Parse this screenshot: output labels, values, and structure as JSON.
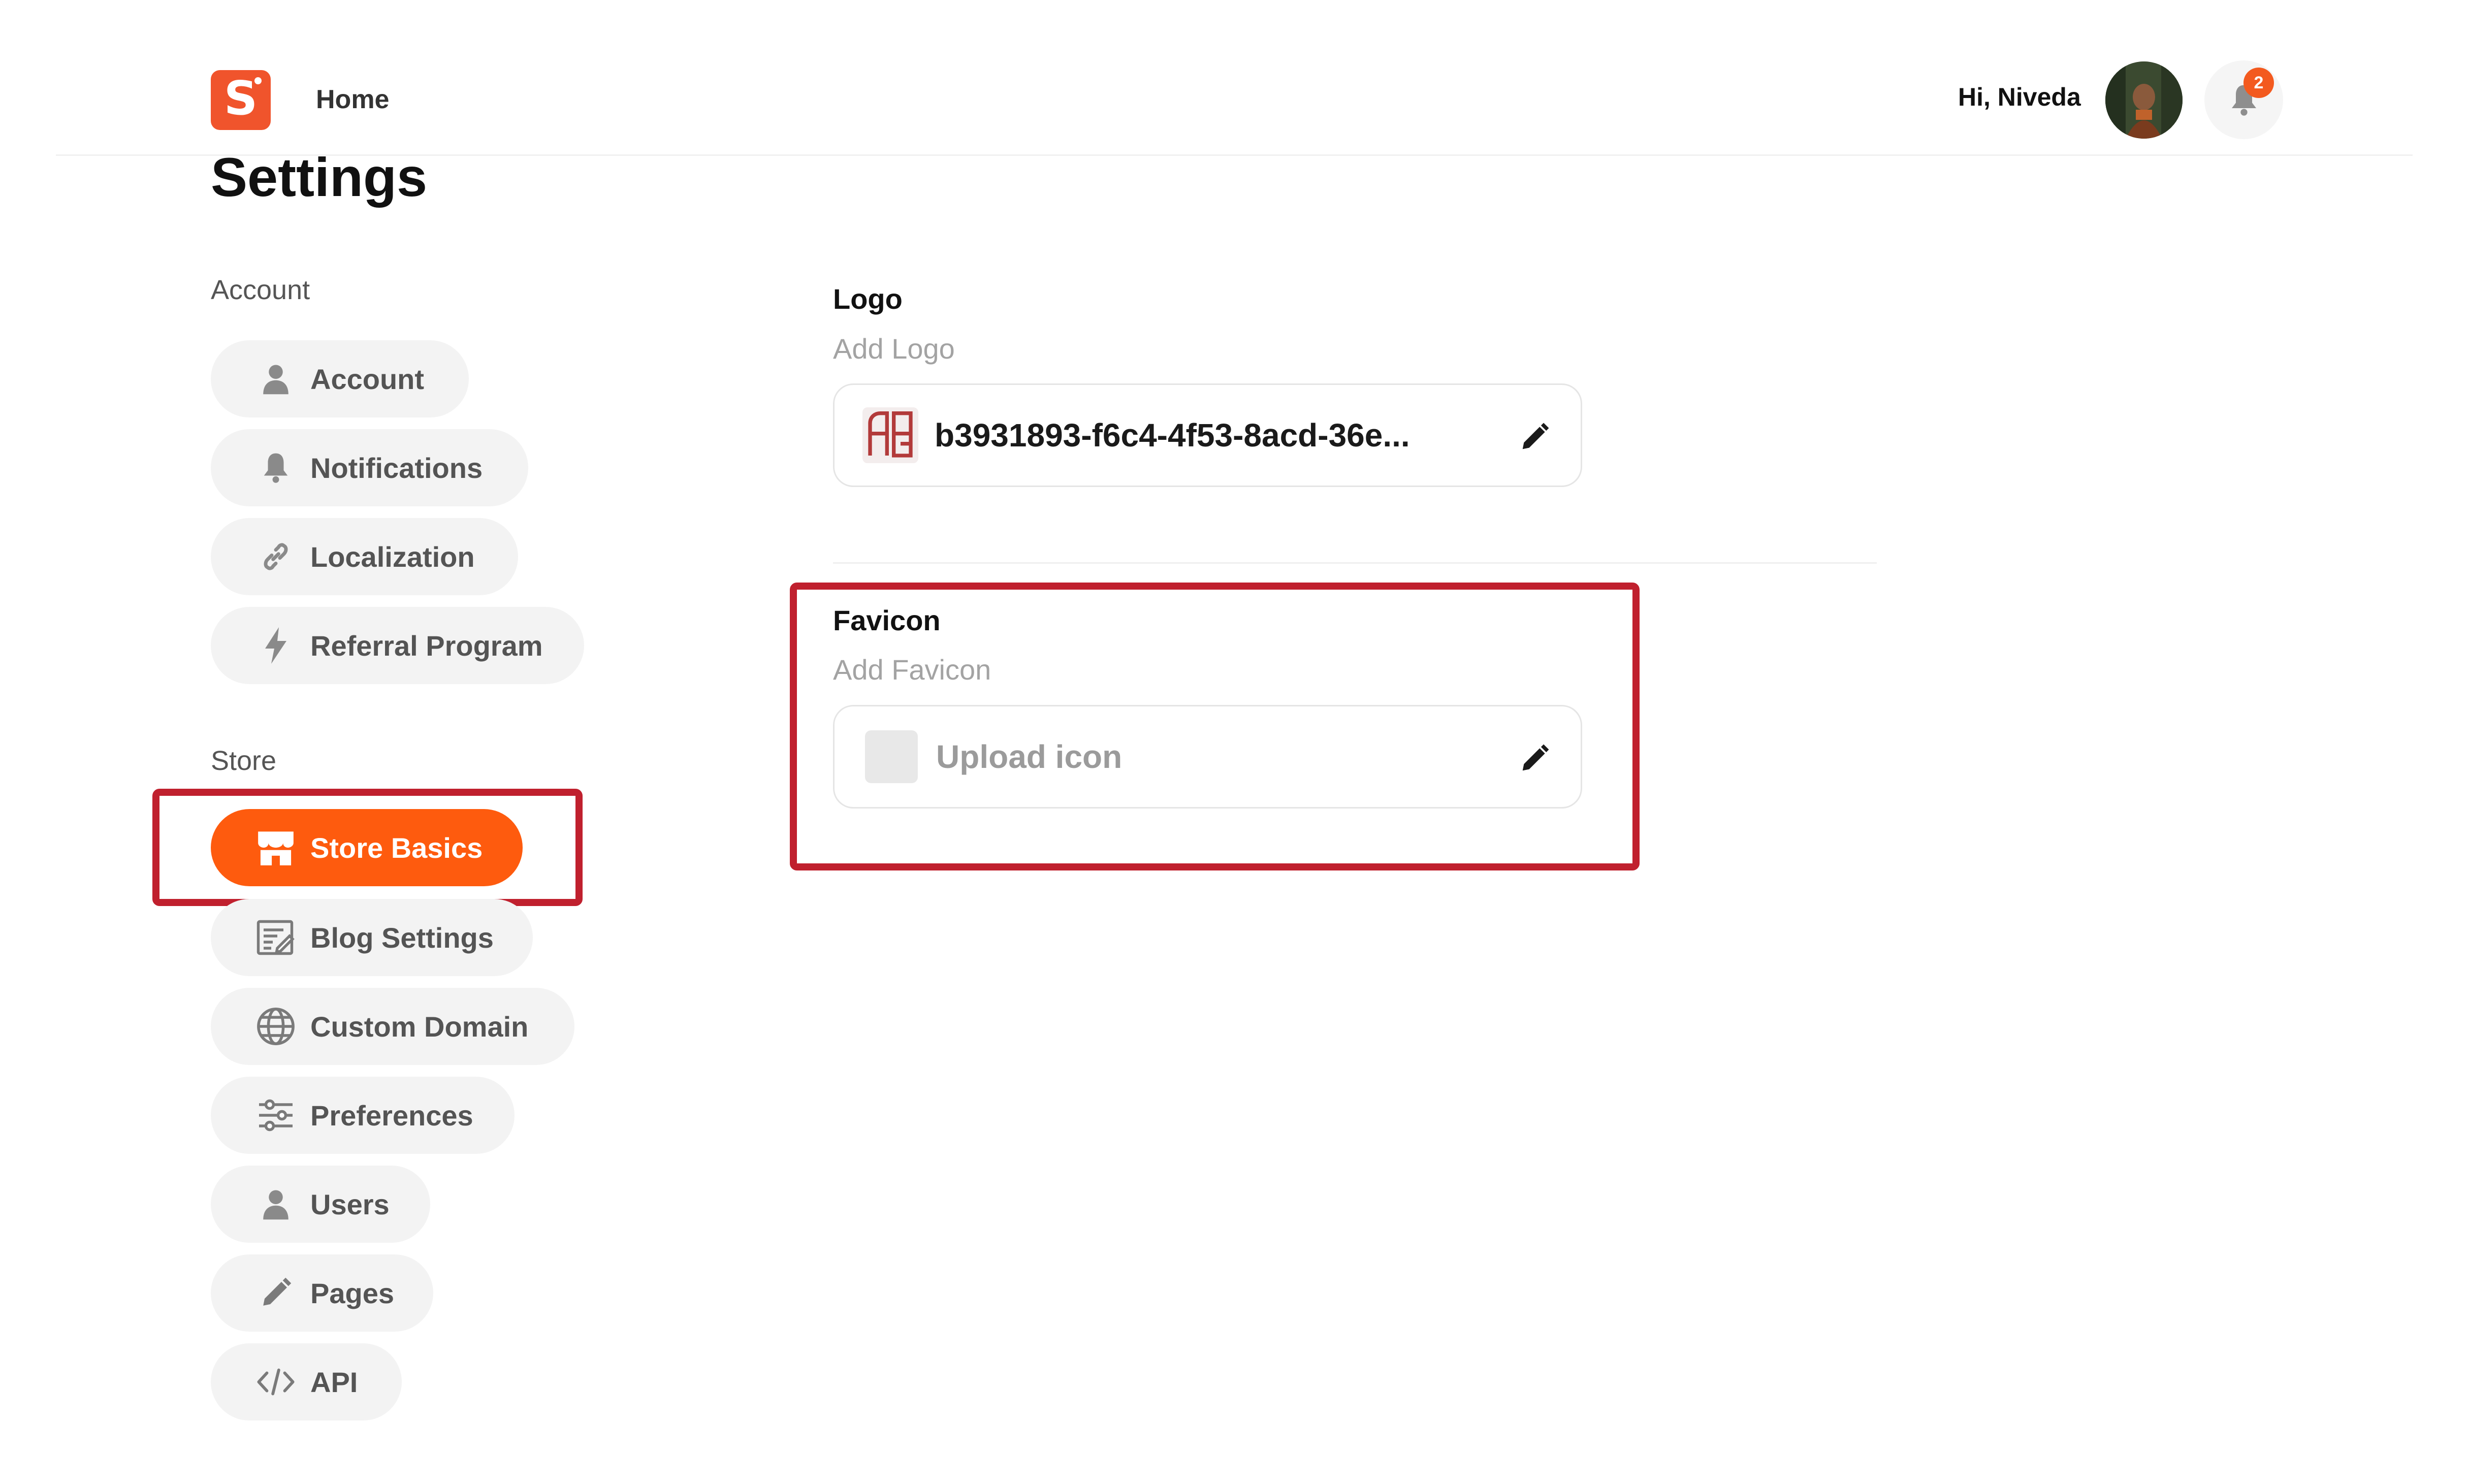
{
  "header": {
    "home_label": "Home",
    "greeting": "Hi, Niveda",
    "notification_count": "2",
    "brand_letter": "S"
  },
  "page": {
    "title": "Settings"
  },
  "sidebar": {
    "account_section": "Account",
    "account_items": [
      {
        "label": "Account",
        "icon": "user-icon"
      },
      {
        "label": "Notifications",
        "icon": "bell-icon"
      },
      {
        "label": "Localization",
        "icon": "link-icon"
      },
      {
        "label": "Referral Program",
        "icon": "lightning-icon"
      }
    ],
    "store_section": "Store",
    "store_items": [
      {
        "label": "Store Basics",
        "icon": "store-icon",
        "active": true
      },
      {
        "label": "Blog Settings",
        "icon": "blog-icon"
      },
      {
        "label": "Custom Domain",
        "icon": "globe-icon"
      },
      {
        "label": "Preferences",
        "icon": "sliders-icon"
      },
      {
        "label": "Users",
        "icon": "user-icon"
      },
      {
        "label": "Pages",
        "icon": "pencil-icon"
      },
      {
        "label": "API",
        "icon": "code-icon"
      }
    ]
  },
  "main": {
    "logo": {
      "title": "Logo",
      "subtitle": "Add Logo",
      "file_name": "b3931893-f6c4-4f53-8acd-36e..."
    },
    "favicon": {
      "title": "Favicon",
      "subtitle": "Add Favicon",
      "placeholder": "Upload icon"
    }
  },
  "colors": {
    "brand": "#f0542c",
    "active_nav": "#fe5b0e",
    "highlight": "#c0202e",
    "badge": "#f35a1f"
  }
}
